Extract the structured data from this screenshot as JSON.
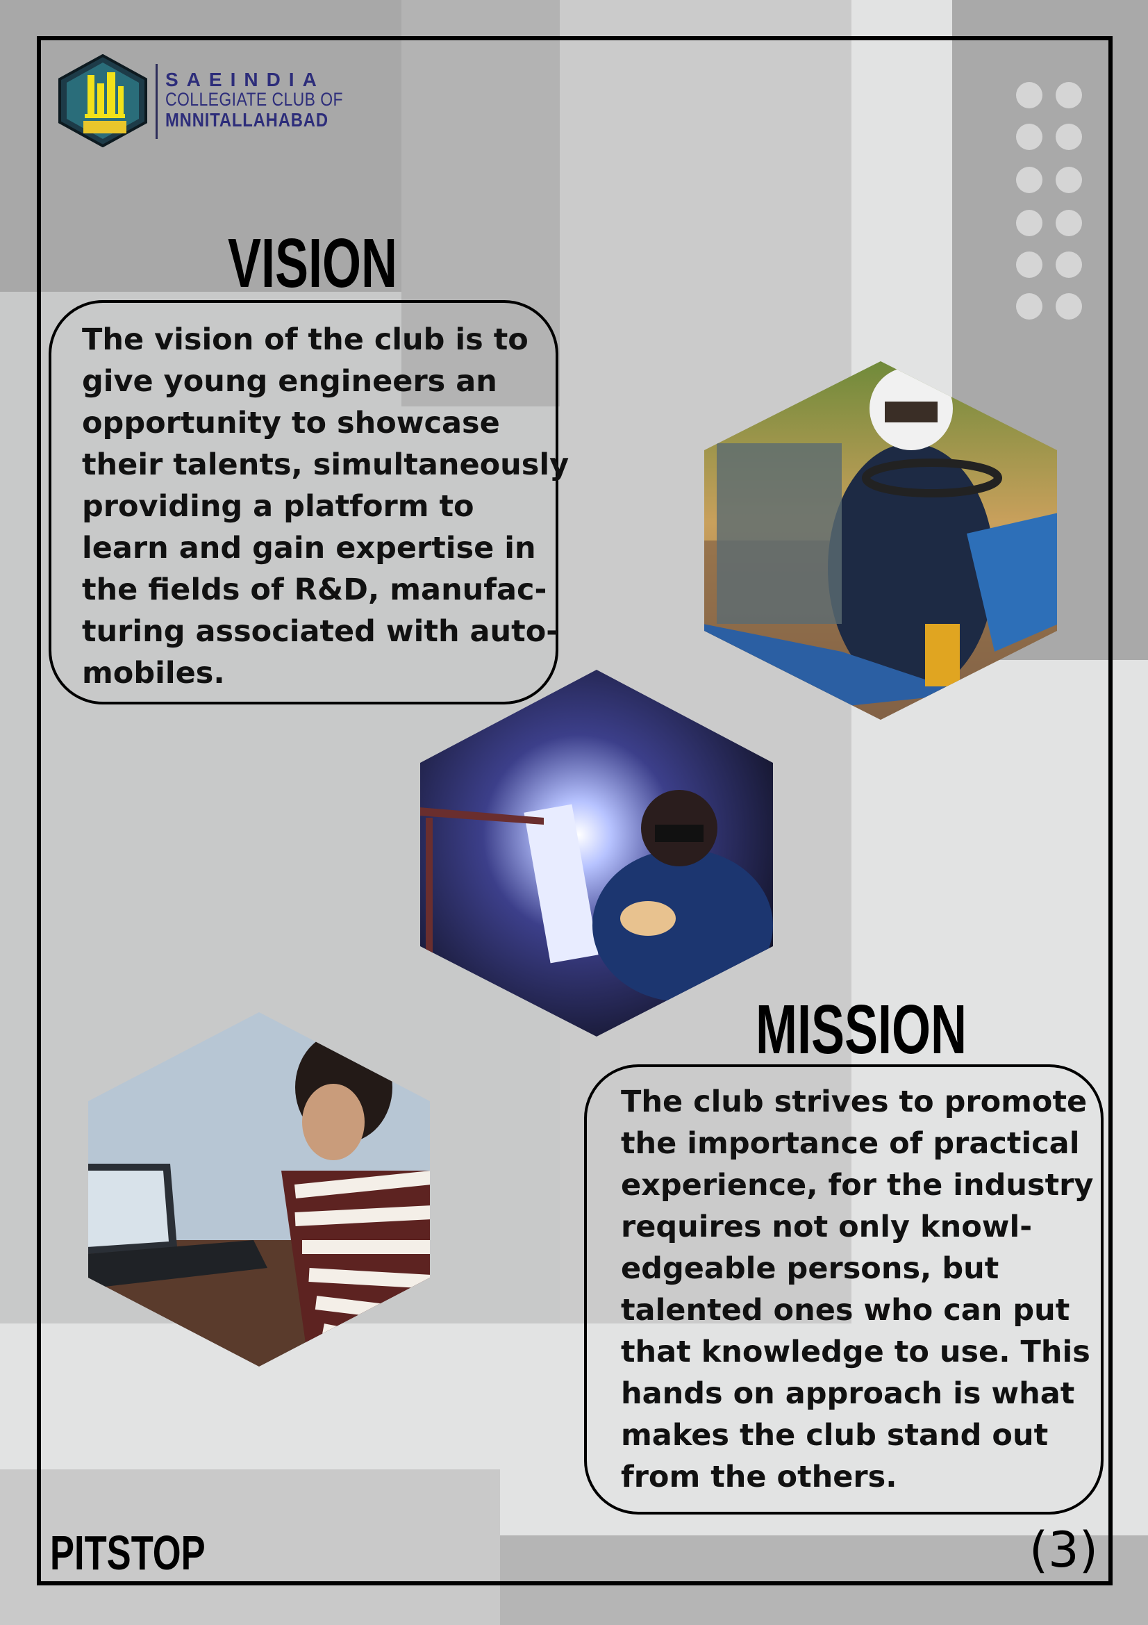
{
  "header": {
    "logo_badge_text": "SAE CLUB MNNIT",
    "logo_line1": "SAEINDIA",
    "logo_line2": "COLLEGIATE CLUB OF",
    "logo_line3": "MNNITALLAHABAD"
  },
  "vision": {
    "title": "VISION",
    "text": "The vision of the club is to\ngive young engineers an\nopportunity to showcase\ntheir talents, simultaneously\nproviding a platform to\nlearn and gain expertise in\nthe fields of R&D, manufac-\nturing associated with auto-\nmobiles."
  },
  "mission": {
    "title": "MISSION",
    "text": "The club strives to promote\nthe importance of practical\nexperience, for the industry\nrequires not only knowl-\nedgeable persons, but\ntalented ones who can put\nthat knowledge to use. This\nhands on approach is what\nmakes the club stand out\nfrom the others."
  },
  "photos": [
    {
      "name": "go-kart-driver-photo"
    },
    {
      "name": "welding-photo"
    },
    {
      "name": "laptop-design-photo"
    }
  ],
  "footer": {
    "magazine_name": "PITSTOP",
    "page_number": "(3)"
  },
  "colors": {
    "background": "#c8c9c9",
    "dark_panel": "#a9a9a9",
    "light_panel": "#e2e3e3",
    "logo_text": "#2d2d7a"
  }
}
